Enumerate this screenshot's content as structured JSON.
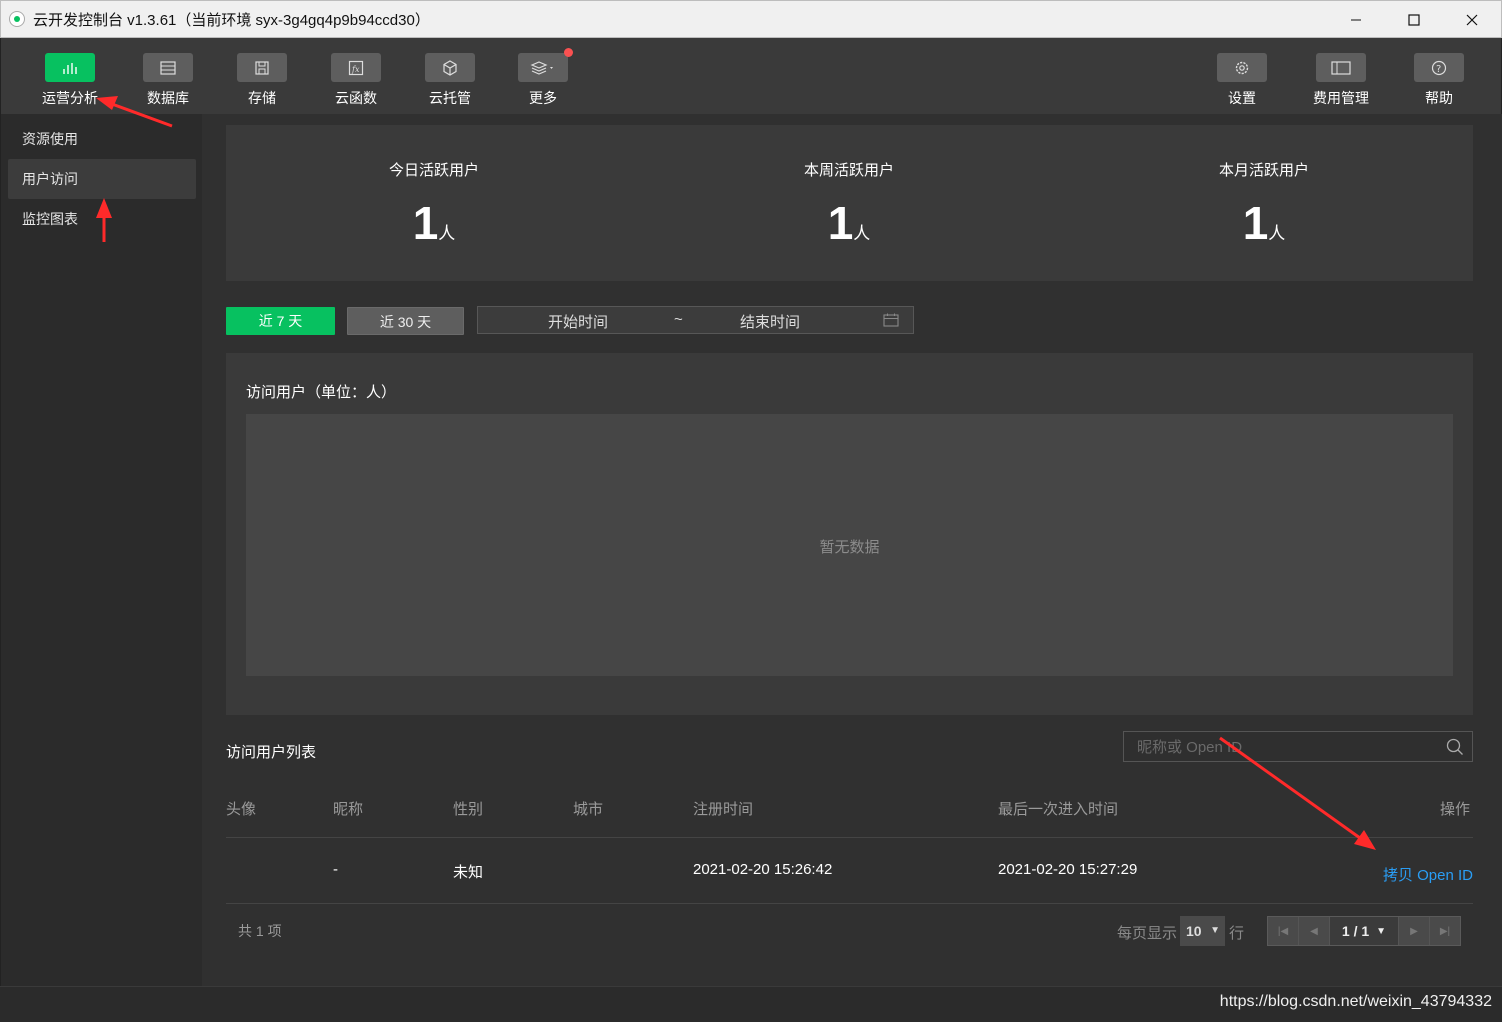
{
  "window": {
    "title": "云开发控制台 v1.3.61（当前环境 syx-3g4gq4p9b94ccd30）"
  },
  "toolbar": {
    "left": [
      {
        "label": "运营分析",
        "icon": "bar-chart-icon",
        "active": true
      },
      {
        "label": "数据库",
        "icon": "database-icon"
      },
      {
        "label": "存储",
        "icon": "save-icon"
      },
      {
        "label": "云函数",
        "icon": "function-icon"
      },
      {
        "label": "云托管",
        "icon": "cube-icon"
      },
      {
        "label": "更多",
        "icon": "layers-icon",
        "badge": true
      }
    ],
    "right": [
      {
        "label": "设置",
        "icon": "gear-icon"
      },
      {
        "label": "费用管理",
        "icon": "billing-icon"
      },
      {
        "label": "帮助",
        "icon": "help-icon"
      }
    ]
  },
  "sidebar": {
    "items": [
      {
        "label": "资源使用"
      },
      {
        "label": "用户访问",
        "active": true
      },
      {
        "label": "监控图表"
      }
    ]
  },
  "stats": [
    {
      "label": "今日活跃用户",
      "value": "1",
      "unit": "人"
    },
    {
      "label": "本周活跃用户",
      "value": "1",
      "unit": "人"
    },
    {
      "label": "本月活跃用户",
      "value": "1",
      "unit": "人"
    }
  ],
  "filters": {
    "range7": "近 7 天",
    "range30": "近 30 天",
    "start_placeholder": "开始时间",
    "separator": "~",
    "end_placeholder": "结束时间"
  },
  "chart": {
    "title": "访问用户（单位：人）",
    "empty_text": "暂无数据"
  },
  "user_list": {
    "title": "访问用户列表",
    "search_placeholder": "昵称或 Open ID",
    "columns": [
      "头像",
      "昵称",
      "性别",
      "城市",
      "注册时间",
      "最后一次进入时间",
      "操作"
    ],
    "rows": [
      {
        "avatar": "",
        "nickname": "-",
        "gender": "未知",
        "city": "",
        "registered": "2021-02-20 15:26:42",
        "last_visit": "2021-02-20 15:27:29",
        "action": "拷贝 Open ID"
      }
    ],
    "total": "共 1 项",
    "per_page_label": "每页显示",
    "per_page_value": "10",
    "per_page_suffix": "行",
    "page_indicator": "1 / 1"
  },
  "status": {
    "watermark": "https://blog.csdn.net/weixin_43794332"
  },
  "colors": {
    "accent": "#07c160",
    "link": "#2a9df4",
    "badge": "#fa5151",
    "annotation": "#ff2a2a"
  }
}
